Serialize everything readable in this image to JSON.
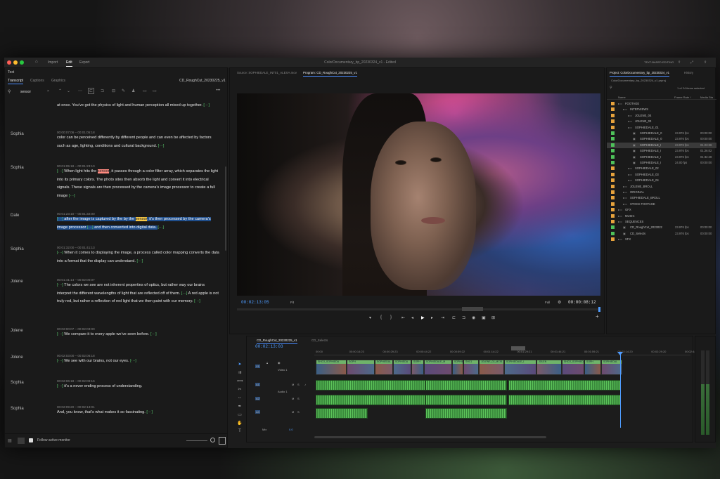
{
  "app": {
    "title": "ColorDocumentary_bp_20230324_v1 - Edited",
    "workspace": "TEXT-BASED EDITING"
  },
  "menu": {
    "home": "⌂",
    "items": [
      "Import",
      "Edit",
      "Export"
    ],
    "active": "Edit"
  },
  "text_panel": {
    "label": "Text",
    "tabs": [
      "Transcript",
      "Captions",
      "Graphics"
    ],
    "active_tab": "Transcript",
    "sequence": "CD_RoughCut_20230225_v1",
    "search_value": "sensor",
    "more": "•••",
    "footer_label": "Follow active monitor"
  },
  "transcript": [
    {
      "speaker": "",
      "time": "",
      "text": "at once. You’ve got the physics of light and human perception all mixed up together. [···]"
    },
    {
      "speaker": "Sophia",
      "time": "00:00:07:06 – 00:01:05:18",
      "text": "color can be perceived differently by different people and can even be affected by factors such as age, lighting, conditions and cultural background. [···]"
    },
    {
      "speaker": "Sophia",
      "time": "00:01:05:18 – 00:01:23:10",
      "text": "[···] When light hits the sensor, it passes through a color filter array, which separates the light into its primary colors. The photo sites then absorb the light and convert it into electrical signals. These signals are then processed by the camera’s image processor to create a full image [···]"
    },
    {
      "speaker": "Dale",
      "time": "00:01:23:10 – 00:01:32:00",
      "text": "[···] after the image is captured by the by the sensor, it’s then processed by the camera’s image processor [···] and then converted into digital data. [···]"
    },
    {
      "speaker": "Sophia",
      "time": "00:01:32:00 – 00:01:41:13",
      "text": "[···] When it comes to displaying the image, a process called color mapping converts the data into a format that the display can understand. [···]"
    },
    {
      "speaker": "Jolene",
      "time": "00:01:41:14 – 00:02:00:07",
      "text": "[···] The colors we see are not inherent properties of optics, but rather way our brains interpret the different wavelengths of light that are reflected off of them. [···] A red apple is not truly red, but rather a reflection of red light that we then paint with our memory. [···]"
    },
    {
      "speaker": "Jolene",
      "time": "00:02:00:07 – 00:02:03:00",
      "text": "[···] We compare it to every apple we’ve seen before. [···]"
    },
    {
      "speaker": "Jolene",
      "time": "00:02:03:00 – 00:02:06:18",
      "text": "[···] We see with our brains, not our eyes. [···]"
    },
    {
      "speaker": "Sophia",
      "time": "00:02:06:18 – 00:02:09:16",
      "text": "[···] it’s a never ending process of understanding."
    },
    {
      "speaker": "Sophia",
      "time": "00:02:09:20 – 00:02:13:01",
      "text": "And, you know, that’s what makes it so fascinating. [···]"
    }
  ],
  "source_monitor": {
    "label": "Source: SOPHIEDALE_INT01_ALEXA.mov"
  },
  "program_monitor": {
    "label": "Program: CD_RoughCut_20230225_v1",
    "timecode": "00:02:13:05",
    "fit": "Fit",
    "quality": "Full",
    "duration": "00:00:08:12"
  },
  "project": {
    "label": "Project: ColorDocumentary_bp_20230324_v1",
    "history": "History",
    "file": "ColorDocumentary_bp_20230324_v1.prproj",
    "selection": "1 of 24 items selected",
    "col_name": "Name",
    "col_fps": "Frame Rate ↑",
    "col_media": "Media Sta",
    "rows": [
      {
        "depth": 0,
        "name": "FOOTAGE",
        "fps": "",
        "media": "",
        "color": "#e6a23c",
        "folder": true
      },
      {
        "depth": 1,
        "name": "INTERVIEWS",
        "fps": "",
        "media": "",
        "color": "#e6a23c",
        "folder": true
      },
      {
        "depth": 2,
        "name": "JOLENE_04",
        "fps": "",
        "media": "",
        "color": "#e6a23c",
        "folder": true
      },
      {
        "depth": 2,
        "name": "JOLENE_03",
        "fps": "",
        "media": "",
        "color": "#e6a23c",
        "folder": true
      },
      {
        "depth": 2,
        "name": "SOPHIEDALE_01",
        "fps": "",
        "media": "",
        "color": "#e6a23c",
        "folder": true
      },
      {
        "depth": 3,
        "name": "SOPHIEDALE_0",
        "fps": "23.976 fps",
        "media": "00:00:00",
        "color": "#4ec25a",
        "folder": false
      },
      {
        "depth": 3,
        "name": "SOPHIEDALE_0",
        "fps": "23.976 fps",
        "media": "00:00:00",
        "color": "#4ec25a",
        "folder": false
      },
      {
        "depth": 3,
        "name": "SOPHIEDALE_I",
        "fps": "23.976 fps",
        "media": "01:23:36",
        "color": "#4ec25a",
        "folder": false
      },
      {
        "depth": 3,
        "name": "SOPHIEDALE_I",
        "fps": "23.976 fps",
        "media": "01:26:02",
        "color": "#4ec25a",
        "folder": false
      },
      {
        "depth": 3,
        "name": "SOPHIEDALE_I",
        "fps": "23.976 fps",
        "media": "01:32:48",
        "color": "#4ec25a",
        "folder": false
      },
      {
        "depth": 3,
        "name": "SOPHIEDALE_I",
        "fps": "24.00 fps",
        "media": "00:00:00",
        "color": "#4ec25a",
        "folder": false
      },
      {
        "depth": 2,
        "name": "SOPHIEDALE_02",
        "fps": "",
        "media": "",
        "color": "#e6a23c",
        "folder": true
      },
      {
        "depth": 2,
        "name": "SOPHIEDALE_03",
        "fps": "",
        "media": "",
        "color": "#e6a23c",
        "folder": true
      },
      {
        "depth": 2,
        "name": "SOPHIEDALE_04",
        "fps": "",
        "media": "",
        "color": "#e6a23c",
        "folder": true
      },
      {
        "depth": 1,
        "name": "JOLENE_BROLL",
        "fps": "",
        "media": "",
        "color": "#e6a23c",
        "folder": true
      },
      {
        "depth": 1,
        "name": "ORIGINAL",
        "fps": "",
        "media": "",
        "color": "#e6a23c",
        "folder": true
      },
      {
        "depth": 1,
        "name": "SOPHIEDALE_BROLL",
        "fps": "",
        "media": "",
        "color": "#e6a23c",
        "folder": true
      },
      {
        "depth": 1,
        "name": "STOCK FOOTAGE",
        "fps": "",
        "media": "",
        "color": "#e6a23c",
        "folder": true
      },
      {
        "depth": 0,
        "name": "GFX",
        "fps": "",
        "media": "",
        "color": "#e6a23c",
        "folder": true
      },
      {
        "depth": 0,
        "name": "MUSIC",
        "fps": "",
        "media": "",
        "color": "#e6a23c",
        "folder": true
      },
      {
        "depth": 0,
        "name": "SEQUENCES",
        "fps": "",
        "media": "",
        "color": "#e6a23c",
        "folder": true
      },
      {
        "depth": 1,
        "name": "CD_RoughCut_2023022",
        "fps": "23.976 fps",
        "media": "00:00:00",
        "color": "#4ec25a",
        "folder": false
      },
      {
        "depth": 1,
        "name": "CD_Selects",
        "fps": "23.976 fps",
        "media": "00:00:00",
        "color": "#4ec25a",
        "folder": false
      },
      {
        "depth": 0,
        "name": "SFX",
        "fps": "",
        "media": "",
        "color": "#e6a23c",
        "folder": true
      }
    ]
  },
  "timeline": {
    "tabs": [
      "CD_RoughCut_20230225_v1",
      "CD_Selects"
    ],
    "timecode": "00:02:13:03",
    "ruler": [
      "00:00",
      "00:00:14:23",
      "00:00:29:23",
      "00:00:44:22",
      "00:00:59:22",
      "00:01:14:22",
      "00:01:29:21",
      "00:01:44:21",
      "00:01:59:21",
      "00:02:14:20",
      "00:02:29:20",
      "00:02:44:20"
    ],
    "video_tracks": [
      {
        "name": "V1",
        "label": "Video 1"
      }
    ],
    "audio_tracks": [
      {
        "name": "A1",
        "label": "Audio 1"
      },
      {
        "name": "A2",
        "label": ""
      },
      {
        "name": "A3",
        "label": ""
      }
    ],
    "mix": "Mix",
    "mix_value": "0.0",
    "clips": [
      "SHCO_SOPHIEDA",
      "SOPH",
      "SOPHIEDAL",
      "SOPHIEDA",
      "SOPH",
      "SOPHIEDALE_M",
      "SOPHIEDALE_I",
      "SHC1",
      "JOLENE_02_MC51",
      "SOPHIEDALE_I",
      "JOLEN"
    ]
  }
}
